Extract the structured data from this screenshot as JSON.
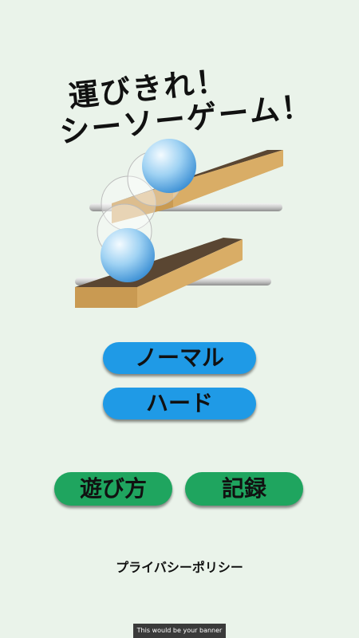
{
  "title": {
    "line1": "運びきれ！",
    "line2": "シーソーゲーム！"
  },
  "menu": {
    "normal_label": "ノーマル",
    "hard_label": "ハード",
    "howto_label": "遊び方",
    "records_label": "記録"
  },
  "footer": {
    "privacy_label": "プライバシーポリシー",
    "banner_text": "This would be your banner"
  },
  "colors": {
    "background": "#eaf3ea",
    "primary_button": "#1f9ae6",
    "secondary_button": "#1fa55f",
    "plank_top": "#5a4632",
    "plank_side": "#d4a862"
  }
}
